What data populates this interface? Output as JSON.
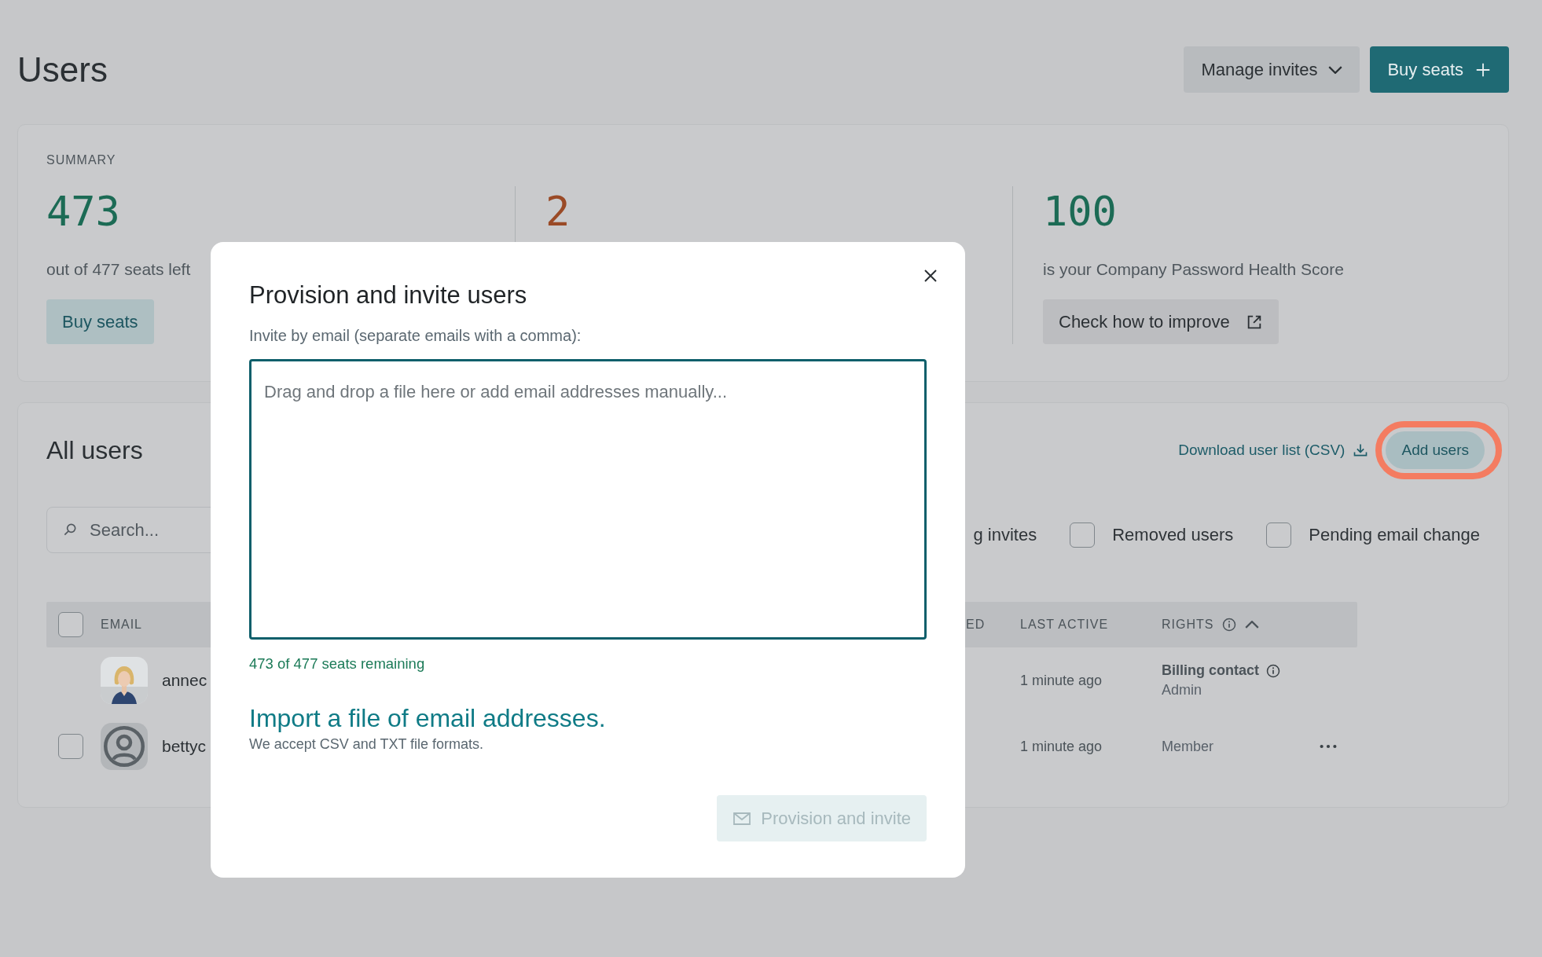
{
  "page": {
    "title": "Users"
  },
  "header_buttons": [
    {
      "label": "Manage invites",
      "kind": "dropdown"
    },
    {
      "label": "Buy seats",
      "kind": "primary"
    }
  ],
  "summary": {
    "heading": "SUMMARY",
    "stats": [
      {
        "value": "473",
        "color": "#1c6b55",
        "caption": "out of 477 seats left",
        "button": {
          "label": "Buy seats",
          "kind": "soft"
        }
      },
      {
        "value": "2",
        "color": "#9a4a26"
      },
      {
        "value": "100",
        "color": "#1c6b55",
        "caption": "is your Company Password Health Score",
        "button": {
          "label": "Check how to improve",
          "kind": "external"
        }
      }
    ]
  },
  "all_users": {
    "title": "All users",
    "download_link": "Download user list (CSV)",
    "add_button": {
      "label": "Add users",
      "highlighted": true
    },
    "search": {
      "placeholder": "Search..."
    },
    "filters": [
      {
        "label": "g invites",
        "kind": "cut"
      },
      {
        "label": "Removed users",
        "kind": "checkbox",
        "checked": false
      },
      {
        "label": "Pending email change",
        "kind": "checkbox",
        "checked": false
      }
    ],
    "table": {
      "select_all": {
        "checked": false
      },
      "columns": [
        {
          "label": "EMAIL"
        },
        {
          "label": "ED"
        },
        {
          "label": "LAST ACTIVE"
        },
        {
          "label": "RIGHTS",
          "info": true,
          "sort_ascending": true
        }
      ],
      "rows": [
        {
          "email": "annec",
          "last_active": "1 minute ago",
          "rights": [
            {
              "text": "Billing contact",
              "kind": "role-info"
            },
            {
              "text": "Admin",
              "kind": "plain"
            }
          ],
          "menu": false
        },
        {
          "checked": false,
          "kind": "default",
          "email": "bettyc",
          "last_active": "1 minute ago",
          "rights": [
            {
              "text": "Member",
              "kind": "plain"
            }
          ],
          "menu": true
        }
      ]
    }
  },
  "modal": {
    "title": "Provision and invite users",
    "label": "Invite by email (separate emails with a comma):",
    "placeholder": "Drag and drop a file here or add email addresses manually...",
    "remaining": "473 of 477 seats remaining",
    "import_link": "Import a file of email addresses.",
    "import_note": "We accept CSV and TXT file formats.",
    "submit": {
      "label": "Provision and invite",
      "disabled": true
    }
  }
}
